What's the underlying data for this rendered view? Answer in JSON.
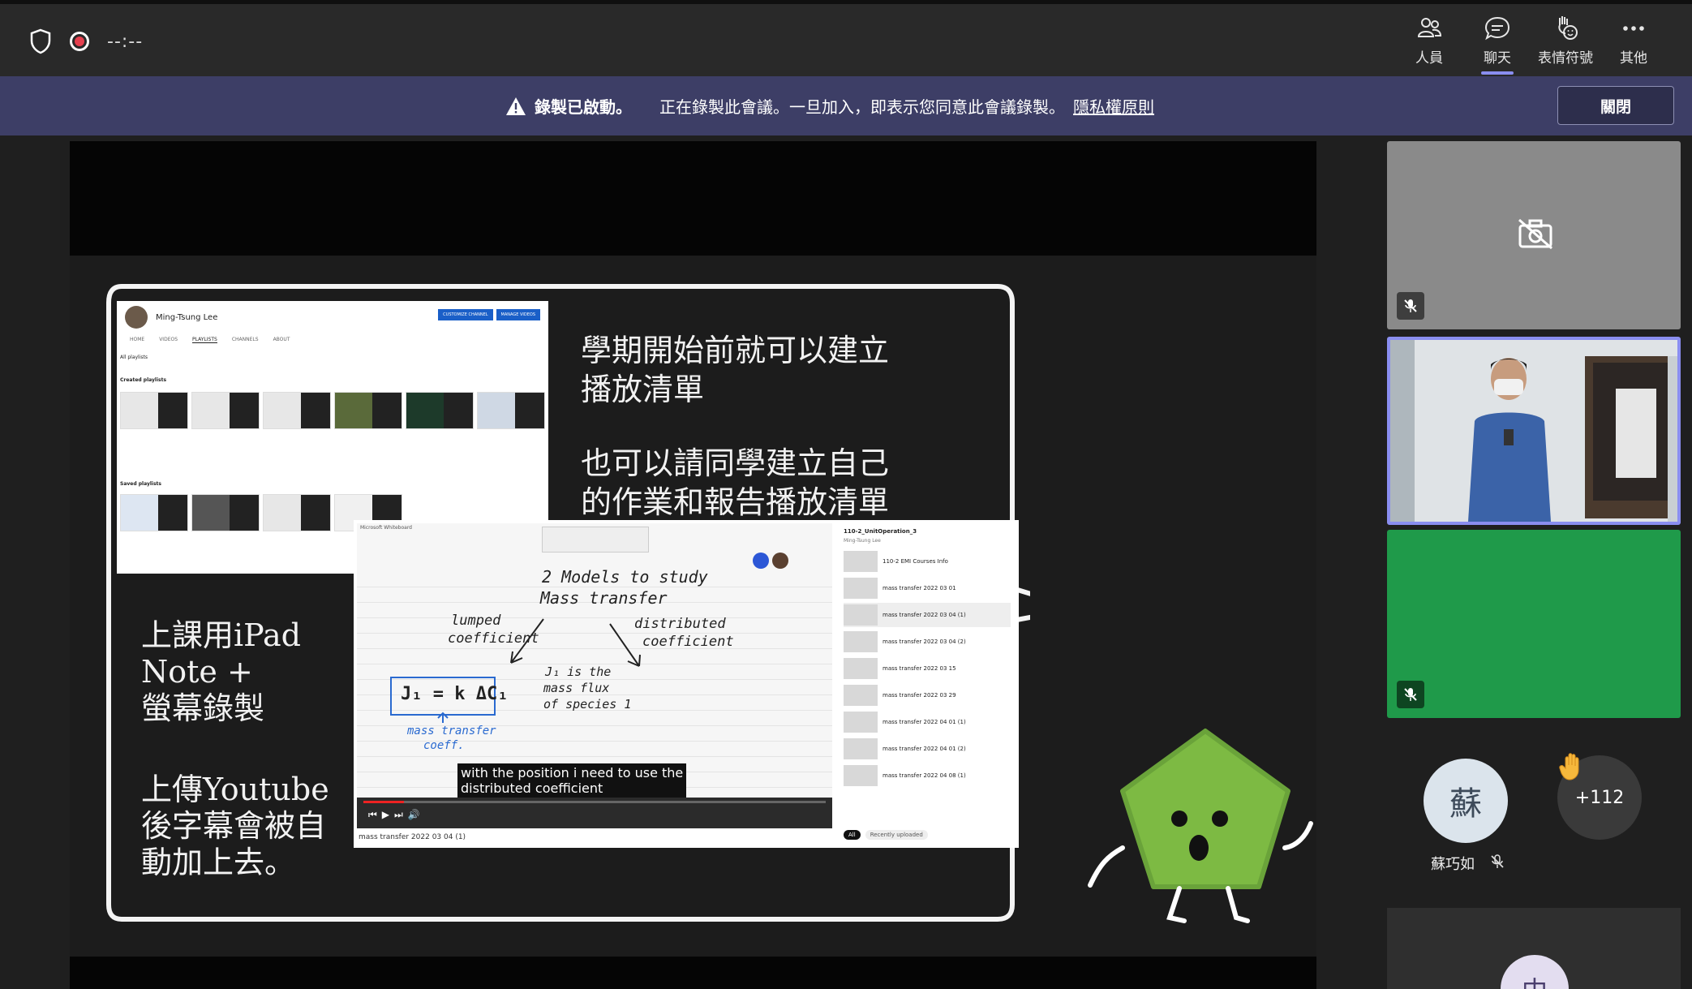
{
  "topbar": {
    "timer": "--:--",
    "buttons": [
      {
        "label": "人員",
        "icon": "people-icon"
      },
      {
        "label": "聊天",
        "icon": "chat-icon"
      },
      {
        "label": "表情符號",
        "icon": "emoji-icon"
      },
      {
        "label": "其他",
        "icon": "more-icon"
      }
    ]
  },
  "banner": {
    "title": "錄製已啟動。",
    "message": "正在錄製此會議。一旦加入，即表示您同意此會議錄製。",
    "privacy_link": "隱私權原則",
    "close_label": "關閉"
  },
  "slide": {
    "text_top": [
      "學期開始前就可以建立",
      "播放清單",
      "",
      "也可以請同學建立自己",
      "的作業和報告播放清單"
    ],
    "text_left_1": [
      "上課用iPad",
      "Note +",
      "螢幕錄製"
    ],
    "text_left_2": [
      "上傳Youtube",
      "後字幕會被自",
      "動加上去。"
    ],
    "youtube": {
      "channel_name": "Ming-Tsung Lee",
      "buttons": [
        "CUSTOMIZE CHANNEL",
        "MANAGE VIDEOS"
      ],
      "tabs": [
        "HOME",
        "VIDEOS",
        "PLAYLISTS",
        "CHANNELS",
        "ABOUT"
      ],
      "section_all": "All playlists",
      "section_created": "Created playlists",
      "section_saved": "Saved playlists"
    },
    "whiteboard": {
      "app_title": "Microsoft Whiteboard",
      "heading_1": "2  Models  to  study",
      "heading_2": "Mass  transfer",
      "left_label_1": "lumped",
      "left_label_2": "coefficient",
      "right_label_1": "distributed",
      "right_label_2": "coefficient",
      "equation": "J₁ = k ΔC₁",
      "blue_note_1": "mass transfer",
      "blue_note_2": "coeff.",
      "note_1": "J₁ is the",
      "note_2": "mass  flux",
      "note_3": "of  species 1",
      "subtitle_1": "with the position i need to use the",
      "subtitle_2": "distributed coefficient",
      "video_caption": "mass transfer 2022 03 04 (1)",
      "playlist_title": "110-2_UnitOperation_3",
      "playlist_owner": "Ming-Tsung Lee",
      "playlist_items": [
        "110-2 EMI Courses Info",
        "mass transfer 2022 03 01",
        "mass transfer 2022 03 04 (1)",
        "mass transfer 2022 03 04 (2)",
        "mass transfer 2022 03 15",
        "mass transfer 2022 03 29",
        "mass transfer 2022 04 01 (1)",
        "mass transfer 2022 04 01 (2)",
        "mass transfer 2022 04 08 (1)"
      ],
      "filter_all": "All",
      "filter_recent": "Recently uploaded"
    }
  },
  "participants": {
    "attendee_initial": "蘇",
    "attendee_name": "蘇巧如",
    "overflow_count": "+112",
    "bottom_initial": "中"
  },
  "colors": {
    "accent": "#8a8ef0",
    "banner": "#3d3e66",
    "record": "#e5404f",
    "green_tile": "#1f9a4a"
  }
}
